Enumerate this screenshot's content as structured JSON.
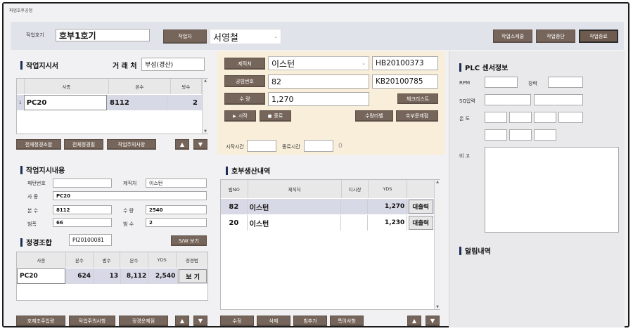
{
  "window": {
    "title": "파업호후공정"
  },
  "header": {
    "job_no_label": "작업호기",
    "job_no_value": "호부1호기",
    "worker_label": "작업자",
    "worker_value": "서영철",
    "btn_schedule": "작업스케줄",
    "btn_stop": "작업중단",
    "btn_end": "작업종료"
  },
  "order": {
    "title": "작업지시서",
    "client_label": "거 래 처",
    "client_value": "부성(경산)",
    "columns": [
      "사종",
      "본수",
      "방수"
    ],
    "rows": [
      {
        "idx": "1",
        "type": "PC20",
        "count": "8112",
        "bang": "2"
      }
    ],
    "btn1": "전체정경조합",
    "btn2": "전체정경필",
    "btn3": "작업주의사항"
  },
  "detail": {
    "title": "작업지시내용",
    "pattern_label": "패턴번호",
    "pattern_value": "",
    "maker_label": "제직처",
    "maker_value": "이스턴",
    "yarn_label": "사 종",
    "yarn_value": "PC20",
    "count_label": "본 수",
    "count_value": "8112",
    "qty_label": "수 량",
    "qty_value": "2540",
    "width_label": "범폭",
    "width_value": "66",
    "bang_label": "범 수",
    "bang_value": "2"
  },
  "combo": {
    "title": "정경조합",
    "code": "PI20100081",
    "btn_sw": "S/W 보기",
    "columns": [
      "사종",
      "본수",
      "범수",
      "본수",
      "YDS",
      "정경범"
    ],
    "rows": [
      {
        "type": "PC20",
        "c1": "624",
        "c2": "13",
        "c3": "8,112",
        "yds": "2,540",
        "btn": "보 기"
      }
    ],
    "btn1": "호제조주입량",
    "btn2": "작업주의사항",
    "btn3": "정경운제점"
  },
  "production": {
    "maker_label": "제직처",
    "maker_value": "이스턴",
    "code1": "HB20100373",
    "beam_label": "공빔번호",
    "beam_value": "82",
    "code2": "KB20100785",
    "qty_label": "수 량",
    "qty_value": "1,270",
    "btn_check": "체크리스트",
    "btn_start": "시작",
    "btn_end": "종료",
    "btn_label_print": "수량라벨",
    "btn_issue": "호부문제점",
    "start_label": "시작시간",
    "end_label": "종료시간",
    "elapsed": "0"
  },
  "history": {
    "title": "호부생산내역",
    "columns": [
      "빔NO",
      "제직처",
      "지시장",
      "YDS"
    ],
    "rows": [
      {
        "no": "82",
        "maker": "이스턴",
        "yds": "1,270",
        "btn": "대출력"
      },
      {
        "no": "20",
        "maker": "이스턴",
        "yds": "1,230",
        "btn": "대출력"
      }
    ],
    "btn_edit": "수정",
    "btn_delete": "삭제",
    "btn_add": "빔추가",
    "btn_note": "특이사항"
  },
  "plc": {
    "title": "PLC 센서정보",
    "rpm_label": "RPM",
    "tension_label": "장력",
    "sq_label": "SQ압력",
    "temp_label": "온 도",
    "note_label": "비 고"
  },
  "alarm": {
    "title": "알림내역"
  }
}
